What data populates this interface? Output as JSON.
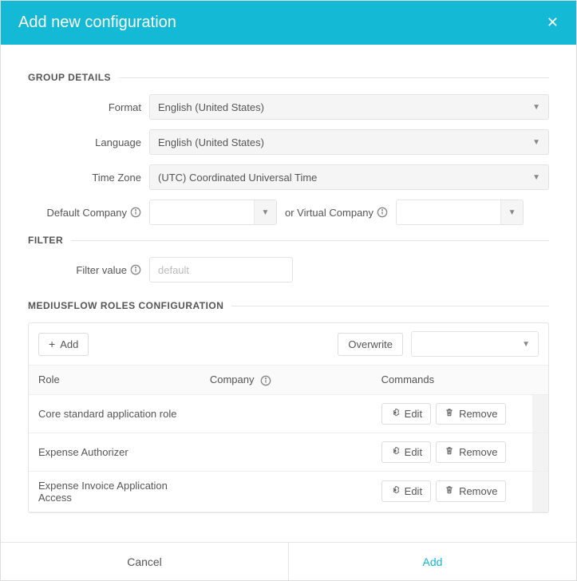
{
  "header": {
    "title": "Add new configuration"
  },
  "sections": {
    "group_details": "GROUP DETAILS",
    "filter": "FILTER",
    "roles": "MEDIUSFLOW ROLES CONFIGURATION"
  },
  "group": {
    "format_label": "Format",
    "format_value": "English (United States)",
    "language_label": "Language",
    "language_value": "English (United States)",
    "timezone_label": "Time Zone",
    "timezone_value": "(UTC) Coordinated Universal Time",
    "default_company_label": "Default Company",
    "default_company_value": "",
    "virtual_company_label": "or Virtual Company",
    "virtual_company_value": ""
  },
  "filter": {
    "label": "Filter value",
    "placeholder": "default",
    "value": ""
  },
  "rolesToolbar": {
    "add": "Add",
    "overwrite": "Overwrite",
    "overwrite_select_value": ""
  },
  "rolesTable": {
    "headers": {
      "role": "Role",
      "company": "Company",
      "commands": "Commands"
    },
    "rows": [
      {
        "role": "Core standard application role",
        "company": ""
      },
      {
        "role": "Expense Authorizer",
        "company": ""
      },
      {
        "role": "Expense Invoice Application Access",
        "company": ""
      }
    ],
    "editLabel": "Edit",
    "removeLabel": "Remove"
  },
  "footer": {
    "cancel": "Cancel",
    "add": "Add"
  }
}
